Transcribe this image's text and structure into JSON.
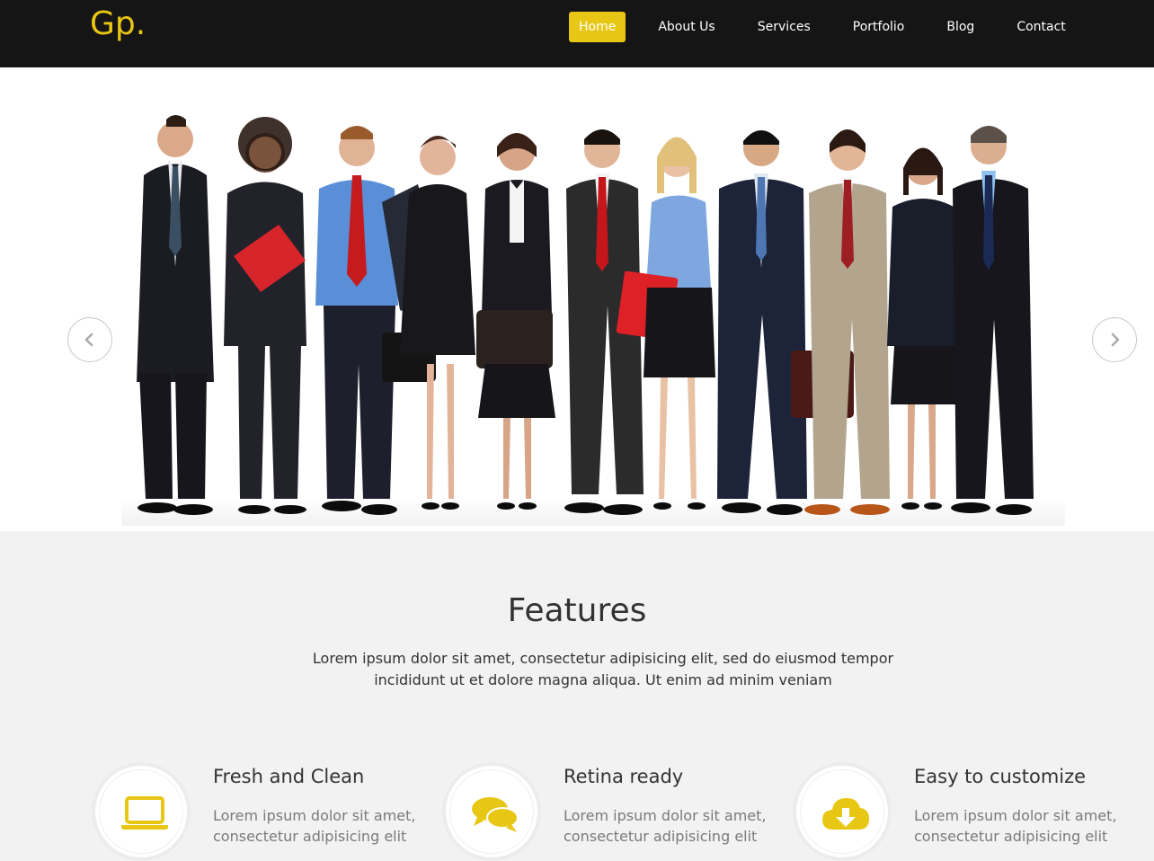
{
  "header": {
    "logo": "Gp.",
    "nav": [
      {
        "label": "Home",
        "active": true
      },
      {
        "label": "About Us",
        "active": false
      },
      {
        "label": "Services",
        "active": false
      },
      {
        "label": "Portfolio",
        "active": false
      },
      {
        "label": "Blog",
        "active": false
      },
      {
        "label": "Contact",
        "active": false
      }
    ]
  },
  "colors": {
    "accent": "#e8c714",
    "header_bg": "#151515",
    "section_bg": "#f2f2f2"
  },
  "hero": {
    "prev_icon": "chevron-left-icon",
    "next_icon": "chevron-right-icon"
  },
  "features": {
    "title": "Features",
    "description": "Lorem ipsum dolor sit amet, consectetur adipisicing elit, sed do eiusmod tempor incididunt ut et dolore magna aliqua. Ut enim ad minim veniam",
    "items": [
      {
        "title": "Fresh and Clean",
        "text": "Lorem ipsum dolor sit amet, consectetur adipisicing elit",
        "icon": "laptop-icon"
      },
      {
        "title": "Retina ready",
        "text": "Lorem ipsum dolor sit amet, consectetur adipisicing elit",
        "icon": "chat-bubbles-icon"
      },
      {
        "title": "Easy to customize",
        "text": "Lorem ipsum dolor sit amet, consectetur adipisicing elit",
        "icon": "cloud-download-icon"
      }
    ]
  }
}
